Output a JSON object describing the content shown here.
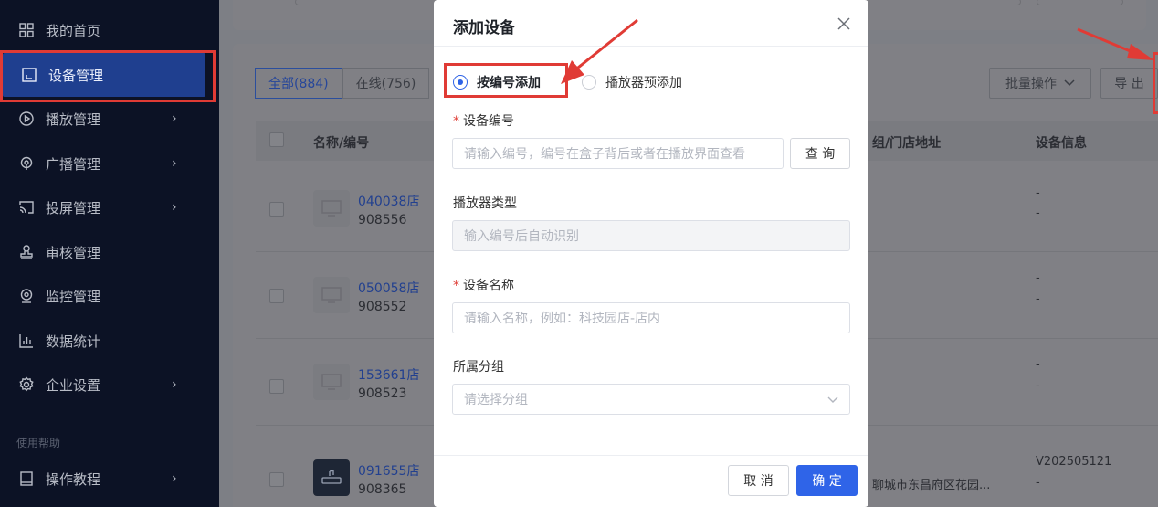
{
  "sidebar": {
    "items": [
      {
        "label": "我的首页",
        "icon": "grid-icon"
      },
      {
        "label": "设备管理",
        "icon": "device-icon"
      },
      {
        "label": "播放管理",
        "icon": "play-icon"
      },
      {
        "label": "广播管理",
        "icon": "broadcast-icon"
      },
      {
        "label": "投屏管理",
        "icon": "cast-icon"
      },
      {
        "label": "审核管理",
        "icon": "stamp-icon"
      },
      {
        "label": "监控管理",
        "icon": "camera-icon"
      },
      {
        "label": "数据统计",
        "icon": "chart-icon"
      },
      {
        "label": "企业设置",
        "icon": "gear-icon"
      }
    ],
    "help_title": "使用帮助",
    "help_items": [
      {
        "label": "操作教程",
        "icon": "book-icon"
      }
    ],
    "chevron": "›"
  },
  "toolbar": {
    "tab_all": "全部(884)",
    "tab_online": "在线(756)",
    "batch_label": "批量操作",
    "export_label": "导 出"
  },
  "table": {
    "headers": {
      "name": "名称/编号",
      "address": "组/门店地址",
      "info": "设备信息"
    },
    "rows": [
      {
        "name": "040038店",
        "code": "908556",
        "info1": "-",
        "info2": "-"
      },
      {
        "name": "050058店",
        "code": "908552",
        "info1": "-",
        "info2": "-"
      },
      {
        "name": "153661店",
        "code": "908523",
        "info1": "-",
        "info2": "-"
      },
      {
        "name": "091655店",
        "code": "908365",
        "address": "聊城市东昌府区花园...",
        "info1": "V202505121",
        "info2": "-"
      }
    ]
  },
  "modal": {
    "title": "添加设备",
    "radio_by_code": "按编号添加",
    "radio_by_player": "播放器预添加",
    "device_code_label": "设备编号",
    "device_code_placeholder": "请输入编号，编号在盒子背后或者在播放界面查看",
    "query_button": "查 询",
    "player_type_label": "播放器类型",
    "player_type_placeholder": "输入编号后自动识别",
    "device_name_label": "设备名称",
    "device_name_placeholder": "请输入名称，例如：科技园店-店内",
    "group_label": "所属分组",
    "group_placeholder": "请选择分组",
    "cancel_button": "取 消",
    "confirm_button": "确 定",
    "required_mark": "*"
  },
  "colors": {
    "primary": "#2f64e8",
    "annotation": "#e03b35",
    "sidebar_bg": "#0c1225"
  }
}
